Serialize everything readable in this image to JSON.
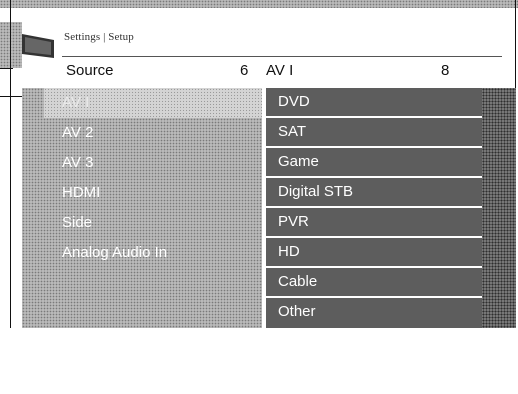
{
  "header": {
    "breadcrumb": "Settings | Setup",
    "source_label": "Source",
    "source_count": "6",
    "selected_source": "AV I",
    "device_count": "8"
  },
  "sources": [
    {
      "label": "AV I",
      "selected": true
    },
    {
      "label": "AV 2",
      "selected": false
    },
    {
      "label": "AV 3",
      "selected": false
    },
    {
      "label": "HDMI",
      "selected": false
    },
    {
      "label": "Side",
      "selected": false
    },
    {
      "label": "Analog Audio In",
      "selected": false
    }
  ],
  "devices": [
    {
      "label": "DVD"
    },
    {
      "label": "SAT"
    },
    {
      "label": "Game"
    },
    {
      "label": "Digital STB"
    },
    {
      "label": "PVR"
    },
    {
      "label": "HD"
    },
    {
      "label": "Cable"
    },
    {
      "label": "Other"
    }
  ],
  "icons": {
    "header": "tv-icon"
  }
}
